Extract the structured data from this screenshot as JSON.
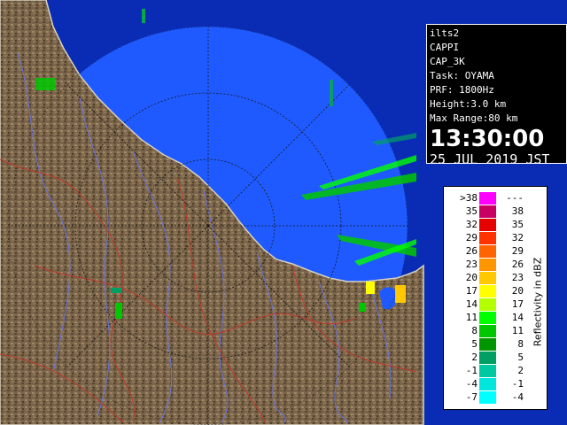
{
  "info": {
    "lines": [
      "ilts2",
      "CAPPI",
      "CAP_3K",
      "Task: OYAMA",
      "PRF: 1800Hz",
      "Height:3.0 km",
      "Max Range:80 km"
    ],
    "time": "13:30:00",
    "date": "25 JUL 2019 JST"
  },
  "legend": {
    "unit": "Reflectivity in dBZ",
    "rows": [
      {
        "lo": ">38",
        "hi": "---",
        "color": "#ff00ff"
      },
      {
        "lo": "35",
        "hi": "38",
        "color": "#c80064"
      },
      {
        "lo": "32",
        "hi": "35",
        "color": "#e60000"
      },
      {
        "lo": "29",
        "hi": "32",
        "color": "#ff3200"
      },
      {
        "lo": "26",
        "hi": "29",
        "color": "#ff6400"
      },
      {
        "lo": "23",
        "hi": "26",
        "color": "#ff9600"
      },
      {
        "lo": "20",
        "hi": "23",
        "color": "#ffc800"
      },
      {
        "lo": "17",
        "hi": "20",
        "color": "#ffff00"
      },
      {
        "lo": "14",
        "hi": "17",
        "color": "#b4ff00"
      },
      {
        "lo": "11",
        "hi": "14",
        "color": "#00ff00"
      },
      {
        "lo": "8",
        "hi": "11",
        "color": "#00c800"
      },
      {
        "lo": "5",
        "hi": "8",
        "color": "#009600"
      },
      {
        "lo": "2",
        "hi": "5",
        "color": "#00a064"
      },
      {
        "lo": "-1",
        "hi": "2",
        "color": "#00c8a0"
      },
      {
        "lo": "-4",
        "hi": "-1",
        "color": "#00e6dc"
      },
      {
        "lo": "-7",
        "hi": "-4",
        "color": "#00ffff"
      }
    ]
  },
  "colors": {
    "sea_inside_range": "#1e5aff",
    "sea_outside_range": "#0a2cb4",
    "land": "#7a654a",
    "rivers": "#6a74e0",
    "boundaries": "#c0392b",
    "range_rings": "#1a1a1a"
  }
}
